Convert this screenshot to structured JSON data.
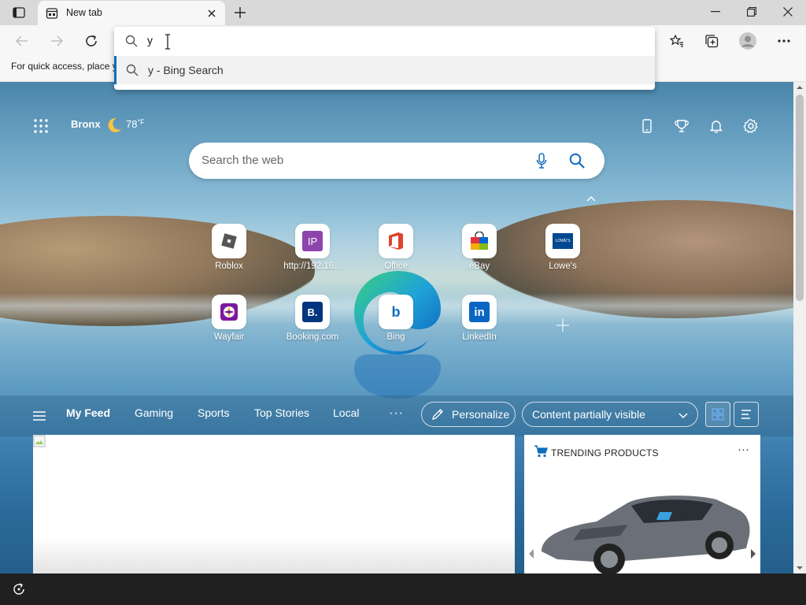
{
  "browser": {
    "tab_title": "New tab",
    "address_value": "y",
    "suggestion": "y - Bing Search",
    "favorites_hint": "For quick access, place y"
  },
  "ntp": {
    "location": "Bronx",
    "temperature": "78",
    "temp_unit": "°F",
    "search_placeholder": "Search the web",
    "tiles": [
      {
        "label": "Roblox",
        "icon": "roblox-icon"
      },
      {
        "label": "http://192.16...",
        "icon": "ip-icon",
        "glyph": "IP"
      },
      {
        "label": "Office",
        "icon": "office-icon"
      },
      {
        "label": "eBay",
        "icon": "ebay-icon"
      },
      {
        "label": "Lowe's",
        "icon": "lowes-icon",
        "glyph": "LOWE'S"
      },
      {
        "label": "Wayfair",
        "icon": "wayfair-icon"
      },
      {
        "label": "Booking.com",
        "icon": "booking-icon",
        "glyph": "B."
      },
      {
        "label": "Bing",
        "icon": "bing-icon",
        "glyph": "b"
      },
      {
        "label": "LinkedIn",
        "icon": "linkedin-icon",
        "glyph": "in"
      }
    ]
  },
  "feed": {
    "tabs": [
      "My Feed",
      "Gaming",
      "Sports",
      "Top Stories",
      "Local"
    ],
    "more": "···",
    "personalize_label": "Personalize",
    "content_visibility": "Content partially visible",
    "trending_title": "TRENDING PRODUCTS",
    "trending_more": "···"
  },
  "colors": {
    "accent": "#0f6cbd",
    "linkedin": "#0a66c2",
    "booking": "#003580",
    "ip": "#8e44ad"
  }
}
